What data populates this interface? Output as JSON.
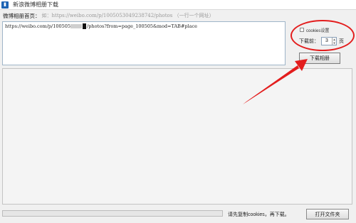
{
  "window": {
    "title": "新浪微博相册下载",
    "icon_name": "app-icon"
  },
  "url_field": {
    "label": "微博相册首页：",
    "hint": "如：https://weibo.com/p/1005053049238742/photos （一行一个网址）",
    "value_prefix": "https://weibo.com/p/100505",
    "value_suffix": "/photos?from=page_100505&mod=TAB#place"
  },
  "options": {
    "checkbox_label": "cookies设置",
    "checked": false,
    "pages_label": "下载前：",
    "pages_value": "3",
    "pages_unit": "页"
  },
  "buttons": {
    "download": "下载相册",
    "open_folder": "打开文件夹"
  },
  "status": {
    "text": "请先复制cookies，再下载。",
    "progress": 0
  },
  "annotation": {
    "color": "#e31d1d"
  }
}
